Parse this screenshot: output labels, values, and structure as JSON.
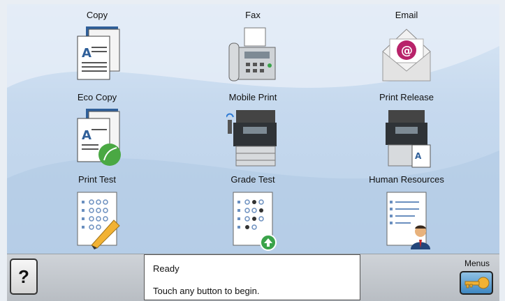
{
  "tiles": [
    {
      "label": "Copy",
      "icon": "copy-icon"
    },
    {
      "label": "Fax",
      "icon": "fax-icon"
    },
    {
      "label": "Email",
      "icon": "email-icon"
    },
    {
      "label": "Eco Copy",
      "icon": "eco-copy-icon"
    },
    {
      "label": "Mobile Print",
      "icon": "mobile-print-icon"
    },
    {
      "label": "Print Release",
      "icon": "print-release-icon"
    },
    {
      "label": "Print Test",
      "icon": "print-test-icon"
    },
    {
      "label": "Grade Test",
      "icon": "grade-test-icon"
    },
    {
      "label": "Human Resources",
      "icon": "human-resources-icon"
    }
  ],
  "bottom_bar": {
    "help_label": "?",
    "status_line1": "Ready",
    "status_line2": "Touch any button to begin.",
    "menus_label": "Menus"
  },
  "colors": {
    "background_blue": "#c6d9ee",
    "bar_gray": "#b8bdc3",
    "menus_button_blue": "#3f88c2"
  }
}
